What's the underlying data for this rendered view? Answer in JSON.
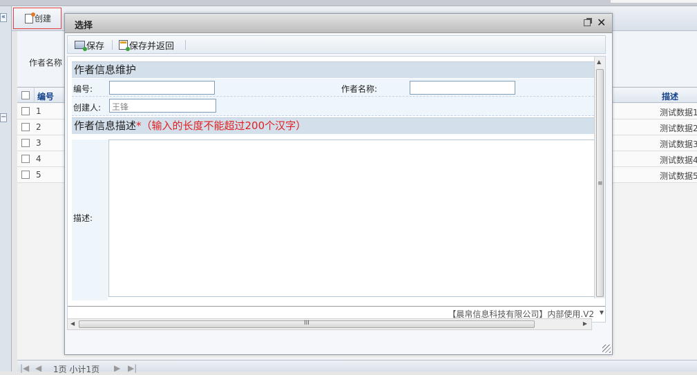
{
  "bg_app": {
    "create_label": "创建",
    "author_name_label": "作者名称",
    "grid": {
      "col_id": "编号",
      "col_desc": "描述",
      "rows": [
        {
          "id": "1",
          "desc": "测试数据1"
        },
        {
          "id": "2",
          "desc": "测试数据2"
        },
        {
          "id": "3",
          "desc": "测试数据3"
        },
        {
          "id": "4",
          "desc": "测试数据4"
        },
        {
          "id": "5",
          "desc": "测试数据5"
        }
      ]
    },
    "pager": {
      "text": "1页 小计1页"
    }
  },
  "dialog": {
    "title": "选择",
    "toolbar": {
      "save_label": "保存",
      "save_return_label": "保存并返回"
    },
    "section1": {
      "title": "作者信息维护"
    },
    "fields": {
      "id_label": "编号:",
      "id_value": "",
      "author_name_label": "作者名称:",
      "author_name_value": "",
      "creator_label": "创建人:",
      "creator_value": "",
      "creator_placeholder": "王锋"
    },
    "section2": {
      "title": "作者信息描述",
      "required_mark": "*",
      "hint": "（输入的长度不能超过200个汉字）"
    },
    "desc_label": "描述:",
    "desc_value": "",
    "copyright": "【晨帛信息科技有限公司】内部使用.V2"
  }
}
